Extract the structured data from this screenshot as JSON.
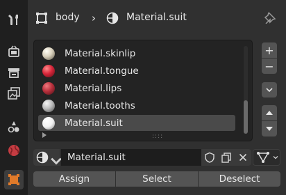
{
  "tabs": [
    {
      "icon": "tool-icon",
      "active": false
    },
    {
      "icon": "render-icon",
      "active": false
    },
    {
      "icon": "output-icon",
      "active": false
    },
    {
      "icon": "view-layer-icon",
      "active": false
    },
    {
      "icon": "scene-icon",
      "active": false
    },
    {
      "icon": "world-icon",
      "active": false
    },
    {
      "icon": "object-icon",
      "active": true
    }
  ],
  "header": {
    "object_name": "body",
    "separator": "›",
    "material_name": "Material.suit"
  },
  "material_slots": [
    {
      "label": "Material.skinlip",
      "color": "#d8d0bc",
      "selected": false
    },
    {
      "label": "Material.tongue",
      "color": "#d8263a",
      "selected": false
    },
    {
      "label": "Material.lips",
      "color": "#b8303c",
      "selected": false
    },
    {
      "label": "Material.tooths",
      "color": "#bcbcbc",
      "selected": false
    },
    {
      "label": "Material.suit",
      "color": "#f2f2f2",
      "selected": true
    }
  ],
  "side_buttons": {
    "add": "+",
    "remove": "−"
  },
  "material_field": {
    "value": "Material.suit"
  },
  "actions": {
    "assign": "Assign",
    "select": "Select",
    "deselect": "Deselect"
  },
  "colors": {
    "panel_bg": "#303030",
    "list_bg": "#232323",
    "button_bg": "#545454",
    "selected_row": "#4a4a4a",
    "world_icon": "#d0464a",
    "object_icon": "#e07a2a"
  }
}
